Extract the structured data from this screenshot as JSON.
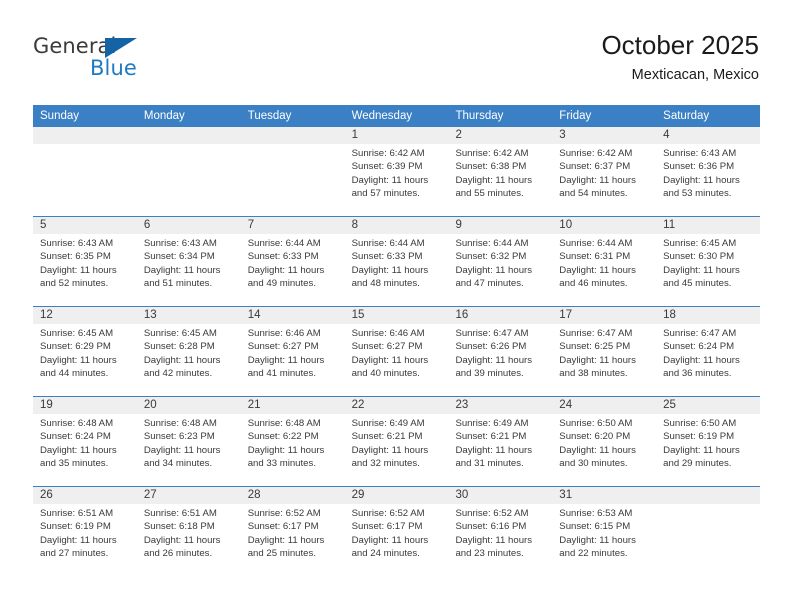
{
  "logo": {
    "word_top": "General",
    "word_bottom": "Blue",
    "triangle_icon": "triangle-icon",
    "accent_color": "#1464a5",
    "blue_text_color": "#1f7ac4"
  },
  "header": {
    "title": "October 2025",
    "subtitle": "Mexticacan, Mexico"
  },
  "theme": {
    "header_blue": "#3b7fc4",
    "day_band_gray": "#efefef",
    "text_color": "#3a3a3a"
  },
  "weekday_headers": [
    "Sunday",
    "Monday",
    "Tuesday",
    "Wednesday",
    "Thursday",
    "Friday",
    "Saturday"
  ],
  "weeks": [
    [
      {
        "day": "",
        "sunrise": "",
        "sunset": "",
        "daylight_line1": "",
        "daylight_line2": ""
      },
      {
        "day": "",
        "sunrise": "",
        "sunset": "",
        "daylight_line1": "",
        "daylight_line2": ""
      },
      {
        "day": "",
        "sunrise": "",
        "sunset": "",
        "daylight_line1": "",
        "daylight_line2": ""
      },
      {
        "day": "1",
        "sunrise": "Sunrise: 6:42 AM",
        "sunset": "Sunset: 6:39 PM",
        "daylight_line1": "Daylight: 11 hours",
        "daylight_line2": "and 57 minutes."
      },
      {
        "day": "2",
        "sunrise": "Sunrise: 6:42 AM",
        "sunset": "Sunset: 6:38 PM",
        "daylight_line1": "Daylight: 11 hours",
        "daylight_line2": "and 55 minutes."
      },
      {
        "day": "3",
        "sunrise": "Sunrise: 6:42 AM",
        "sunset": "Sunset: 6:37 PM",
        "daylight_line1": "Daylight: 11 hours",
        "daylight_line2": "and 54 minutes."
      },
      {
        "day": "4",
        "sunrise": "Sunrise: 6:43 AM",
        "sunset": "Sunset: 6:36 PM",
        "daylight_line1": "Daylight: 11 hours",
        "daylight_line2": "and 53 minutes."
      }
    ],
    [
      {
        "day": "5",
        "sunrise": "Sunrise: 6:43 AM",
        "sunset": "Sunset: 6:35 PM",
        "daylight_line1": "Daylight: 11 hours",
        "daylight_line2": "and 52 minutes."
      },
      {
        "day": "6",
        "sunrise": "Sunrise: 6:43 AM",
        "sunset": "Sunset: 6:34 PM",
        "daylight_line1": "Daylight: 11 hours",
        "daylight_line2": "and 51 minutes."
      },
      {
        "day": "7",
        "sunrise": "Sunrise: 6:44 AM",
        "sunset": "Sunset: 6:33 PM",
        "daylight_line1": "Daylight: 11 hours",
        "daylight_line2": "and 49 minutes."
      },
      {
        "day": "8",
        "sunrise": "Sunrise: 6:44 AM",
        "sunset": "Sunset: 6:33 PM",
        "daylight_line1": "Daylight: 11 hours",
        "daylight_line2": "and 48 minutes."
      },
      {
        "day": "9",
        "sunrise": "Sunrise: 6:44 AM",
        "sunset": "Sunset: 6:32 PM",
        "daylight_line1": "Daylight: 11 hours",
        "daylight_line2": "and 47 minutes."
      },
      {
        "day": "10",
        "sunrise": "Sunrise: 6:44 AM",
        "sunset": "Sunset: 6:31 PM",
        "daylight_line1": "Daylight: 11 hours",
        "daylight_line2": "and 46 minutes."
      },
      {
        "day": "11",
        "sunrise": "Sunrise: 6:45 AM",
        "sunset": "Sunset: 6:30 PM",
        "daylight_line1": "Daylight: 11 hours",
        "daylight_line2": "and 45 minutes."
      }
    ],
    [
      {
        "day": "12",
        "sunrise": "Sunrise: 6:45 AM",
        "sunset": "Sunset: 6:29 PM",
        "daylight_line1": "Daylight: 11 hours",
        "daylight_line2": "and 44 minutes."
      },
      {
        "day": "13",
        "sunrise": "Sunrise: 6:45 AM",
        "sunset": "Sunset: 6:28 PM",
        "daylight_line1": "Daylight: 11 hours",
        "daylight_line2": "and 42 minutes."
      },
      {
        "day": "14",
        "sunrise": "Sunrise: 6:46 AM",
        "sunset": "Sunset: 6:27 PM",
        "daylight_line1": "Daylight: 11 hours",
        "daylight_line2": "and 41 minutes."
      },
      {
        "day": "15",
        "sunrise": "Sunrise: 6:46 AM",
        "sunset": "Sunset: 6:27 PM",
        "daylight_line1": "Daylight: 11 hours",
        "daylight_line2": "and 40 minutes."
      },
      {
        "day": "16",
        "sunrise": "Sunrise: 6:47 AM",
        "sunset": "Sunset: 6:26 PM",
        "daylight_line1": "Daylight: 11 hours",
        "daylight_line2": "and 39 minutes."
      },
      {
        "day": "17",
        "sunrise": "Sunrise: 6:47 AM",
        "sunset": "Sunset: 6:25 PM",
        "daylight_line1": "Daylight: 11 hours",
        "daylight_line2": "and 38 minutes."
      },
      {
        "day": "18",
        "sunrise": "Sunrise: 6:47 AM",
        "sunset": "Sunset: 6:24 PM",
        "daylight_line1": "Daylight: 11 hours",
        "daylight_line2": "and 36 minutes."
      }
    ],
    [
      {
        "day": "19",
        "sunrise": "Sunrise: 6:48 AM",
        "sunset": "Sunset: 6:24 PM",
        "daylight_line1": "Daylight: 11 hours",
        "daylight_line2": "and 35 minutes."
      },
      {
        "day": "20",
        "sunrise": "Sunrise: 6:48 AM",
        "sunset": "Sunset: 6:23 PM",
        "daylight_line1": "Daylight: 11 hours",
        "daylight_line2": "and 34 minutes."
      },
      {
        "day": "21",
        "sunrise": "Sunrise: 6:48 AM",
        "sunset": "Sunset: 6:22 PM",
        "daylight_line1": "Daylight: 11 hours",
        "daylight_line2": "and 33 minutes."
      },
      {
        "day": "22",
        "sunrise": "Sunrise: 6:49 AM",
        "sunset": "Sunset: 6:21 PM",
        "daylight_line1": "Daylight: 11 hours",
        "daylight_line2": "and 32 minutes."
      },
      {
        "day": "23",
        "sunrise": "Sunrise: 6:49 AM",
        "sunset": "Sunset: 6:21 PM",
        "daylight_line1": "Daylight: 11 hours",
        "daylight_line2": "and 31 minutes."
      },
      {
        "day": "24",
        "sunrise": "Sunrise: 6:50 AM",
        "sunset": "Sunset: 6:20 PM",
        "daylight_line1": "Daylight: 11 hours",
        "daylight_line2": "and 30 minutes."
      },
      {
        "day": "25",
        "sunrise": "Sunrise: 6:50 AM",
        "sunset": "Sunset: 6:19 PM",
        "daylight_line1": "Daylight: 11 hours",
        "daylight_line2": "and 29 minutes."
      }
    ],
    [
      {
        "day": "26",
        "sunrise": "Sunrise: 6:51 AM",
        "sunset": "Sunset: 6:19 PM",
        "daylight_line1": "Daylight: 11 hours",
        "daylight_line2": "and 27 minutes."
      },
      {
        "day": "27",
        "sunrise": "Sunrise: 6:51 AM",
        "sunset": "Sunset: 6:18 PM",
        "daylight_line1": "Daylight: 11 hours",
        "daylight_line2": "and 26 minutes."
      },
      {
        "day": "28",
        "sunrise": "Sunrise: 6:52 AM",
        "sunset": "Sunset: 6:17 PM",
        "daylight_line1": "Daylight: 11 hours",
        "daylight_line2": "and 25 minutes."
      },
      {
        "day": "29",
        "sunrise": "Sunrise: 6:52 AM",
        "sunset": "Sunset: 6:17 PM",
        "daylight_line1": "Daylight: 11 hours",
        "daylight_line2": "and 24 minutes."
      },
      {
        "day": "30",
        "sunrise": "Sunrise: 6:52 AM",
        "sunset": "Sunset: 6:16 PM",
        "daylight_line1": "Daylight: 11 hours",
        "daylight_line2": "and 23 minutes."
      },
      {
        "day": "31",
        "sunrise": "Sunrise: 6:53 AM",
        "sunset": "Sunset: 6:15 PM",
        "daylight_line1": "Daylight: 11 hours",
        "daylight_line2": "and 22 minutes."
      },
      {
        "day": "",
        "sunrise": "",
        "sunset": "",
        "daylight_line1": "",
        "daylight_line2": ""
      }
    ]
  ]
}
